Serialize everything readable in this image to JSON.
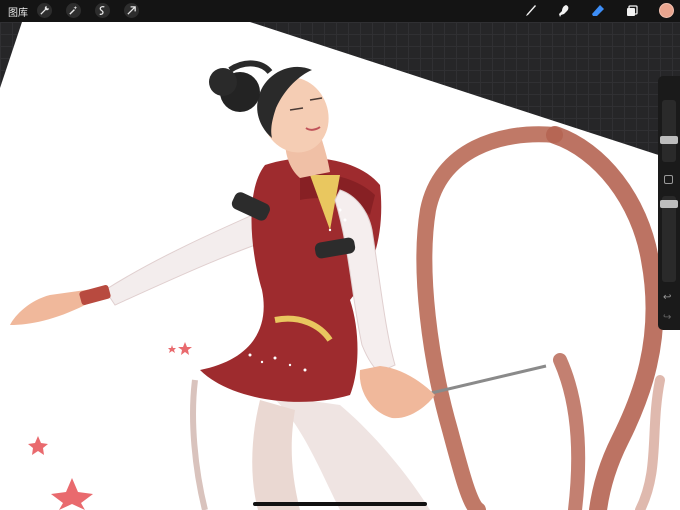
{
  "topbar": {
    "gallery_label": "图库",
    "left_tools": [
      "wrench-icon",
      "magic-wand-icon",
      "selection-icon",
      "transform-arrow-icon"
    ],
    "right_tools": [
      "brush-icon",
      "smudge-icon",
      "eraser-icon",
      "layers-icon"
    ],
    "active_tool": "eraser",
    "active_color": "#e9a58f",
    "accent_color": "#3d8ef7"
  },
  "sidebar": {
    "brush_size_level": 0.25,
    "opacity_level": 0.1,
    "modify_button": "square-icon",
    "undo_icon": "↩",
    "redo_icon": "↪"
  },
  "canvas": {
    "subject": "rhythmic-gymnast-illustration"
  }
}
